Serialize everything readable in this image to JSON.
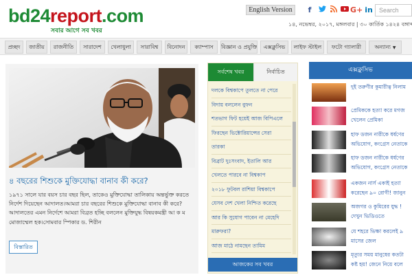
{
  "header": {
    "logo": {
      "part1": "bd24",
      "part2": "report",
      "part3": ".com",
      "tagline": "সবার আগে সব খবর"
    },
    "english_version": "English Version",
    "social": [
      "f",
      "t",
      "rss",
      "yt",
      "G+",
      "in"
    ],
    "search_placeholder": "Search",
    "date": "১৪, নভেম্বর, ২০১৭, মঙ্গলবার | ৩০ কার্তিক ১৪২৪ বঙ্গাব্দ"
  },
  "nav": {
    "items": [
      "প্রচ্ছদ",
      "জাতীয়",
      "রাজনীতি",
      "সারাদেশ",
      "খেলাধুলা",
      "সারাবিশ্ব",
      "বিনোদন",
      "ক্যাম্পাস",
      "বিজ্ঞান ও প্রযুক্তি",
      "এক্সক্লুসিভ",
      "লাইফ স্টাইল",
      "ফটো গ্যালারী",
      "অন্যান্য"
    ]
  },
  "feature": {
    "title": "৪ বছরের শিশুকে মুক্তিযোদ্ধা বানাব কী করে?",
    "summary": "১৯৭১ সালে যার বয়স চার বছর ছিল, তাকেও মুক্তিযোদ্ধা তালিকায় অন্তর্ভুক্ত করতে নির্দেশ দিয়েছেন আদালত।আমরা চার বছরের শিশুকে মুক্তিযোদ্ধা বানাব কী করে? আদালতের এমন নির্দেশে আমরা বিব্রত হচ্ছি বললেন মুক্তিযুদ্ধ বিষয়কমন্ত্রী আ ক ম মোজাম্মেল হক।সোমবার স্পিকার ড. শিরীন",
    "detail_button": "বিস্তারিত"
  },
  "middle": {
    "tab_latest": "সর্বশেষ খবর",
    "tab_selected": "নির্বাচিত",
    "lines": [
      "দলকে বিশ্বকাপে তুলতে না পেরে",
      "বিদায় বললেন বুফন",
      "শতভাগ ফিট হয়েই আজ বিপিএলে",
      "ফিরছেন ভিক্টোরিয়ান্সের সেরা",
      "তারকা",
      "বিব্রাট দুঃসংবাদ, ইতালি আর",
      "খেলতে পারবে না বিশ্বকাপ",
      "২০১৮ ফুটবল রাশিয়া বিশ্বকাপে",
      "যেসব দেশ খেলা নিশ্চিত করেছে",
      "আর কি সুযোগ পাবেন না মেহেদি",
      "মারুফরা?",
      "আজ মাঠে নামছেন তামিম"
    ],
    "all_news_button": "আজকের সব খবর"
  },
  "right": {
    "heading": "এক্সক্লুসিভ",
    "items": [
      {
        "title": "দুই তরুণীর কুমারীত্ব নিলাম"
      },
      {
        "title": "প্রেমিককে হত্যা করে মগজ খেলেন প্রেমিকা"
      },
      {
        "title": "হাফ ডজন নারীকে ধর্ষণের অভিযোগ, কংগ্রেস নেতাকে বহিষ্কার"
      },
      {
        "title": "হাফ ডজন নারীকে ধর্ষণের অভিযোগ, কংগ্রেস নেতাকে বহিষ্কার"
      },
      {
        "title": "একজন নার্স একাই হত্যা করেছেন ৯০ রোগী! জানুন বিস্তারিত"
      },
      {
        "title": "অজগর ও কুমিরের যুদ্ধ ! দেখুন ভিডিওতে"
      },
      {
        "title": "যে শহরে ভিক্ষা করলেই ৯ মাসের জেল"
      },
      {
        "title": "মৃত্যুর সময় মানুষের কতটা কষ্ট হয়! জেনে নিয়ে বলে দিবে"
      }
    ]
  },
  "colors": {
    "brand_green": "#1d8a34",
    "brand_red": "#c4141c",
    "link_blue": "#1565a8",
    "header_blue": "#2a6db4"
  }
}
